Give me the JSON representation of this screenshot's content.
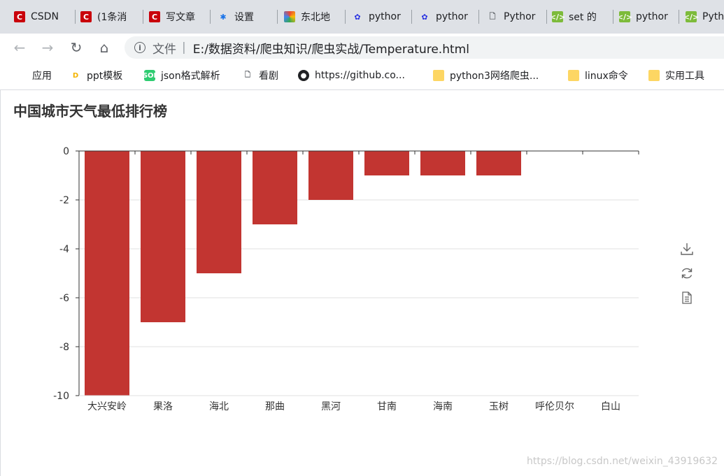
{
  "browser": {
    "tabs": [
      {
        "label": "CSDN",
        "favicon": "csdn-icon"
      },
      {
        "label": "(1条消",
        "favicon": "csdn-icon"
      },
      {
        "label": "写文章",
        "favicon": "csdn-icon"
      },
      {
        "label": "设置",
        "favicon": "gear-icon"
      },
      {
        "label": "东北地",
        "favicon": "swirl-icon"
      },
      {
        "label": "pythor",
        "favicon": "baidu-paw-icon"
      },
      {
        "label": "pythor",
        "favicon": "baidu-paw-icon"
      },
      {
        "label": "Pythor",
        "favicon": "page-icon"
      },
      {
        "label": "set 的",
        "favicon": "code-icon"
      },
      {
        "label": "pythor",
        "favicon": "code-icon"
      },
      {
        "label": "Pyth",
        "favicon": "code-icon"
      }
    ],
    "address": {
      "scheme_label": "文件",
      "separator": "|",
      "url": "E:/数据资料/爬虫知识/爬虫实战/Temperature.html"
    },
    "bookmarks": [
      {
        "label": "应用",
        "icon": "apps-grid-icon"
      },
      {
        "label": "ppt模板",
        "icon": "ppt-icon"
      },
      {
        "label": "json格式解析",
        "icon": "json-icon"
      },
      {
        "label": "看剧",
        "icon": "page-icon"
      },
      {
        "label": "https://github.co...",
        "icon": "github-icon"
      },
      {
        "label": "python3网络爬虫...",
        "icon": "folder-icon"
      },
      {
        "label": "linux命令",
        "icon": "folder-icon"
      },
      {
        "label": "实用工具",
        "icon": "folder-icon"
      }
    ]
  },
  "chart_data": {
    "type": "bar",
    "title": "中国城市天气最低排行榜",
    "categories": [
      "大兴安岭",
      "果洛",
      "海北",
      "那曲",
      "黑河",
      "甘南",
      "海南",
      "玉树",
      "呼伦贝尔",
      "白山"
    ],
    "values": [
      -10,
      -7,
      -5,
      -3,
      -2,
      -1,
      -1,
      -1,
      0,
      0
    ],
    "yticks": [
      0,
      -2,
      -4,
      -6,
      -8,
      -10
    ],
    "ylim": [
      -10,
      0
    ],
    "bar_color": "#c23531",
    "grid": true
  },
  "toolbox": [
    "download-icon",
    "refresh-icon",
    "data-view-icon"
  ],
  "watermark": "https://blog.csdn.net/weixin_43919632"
}
